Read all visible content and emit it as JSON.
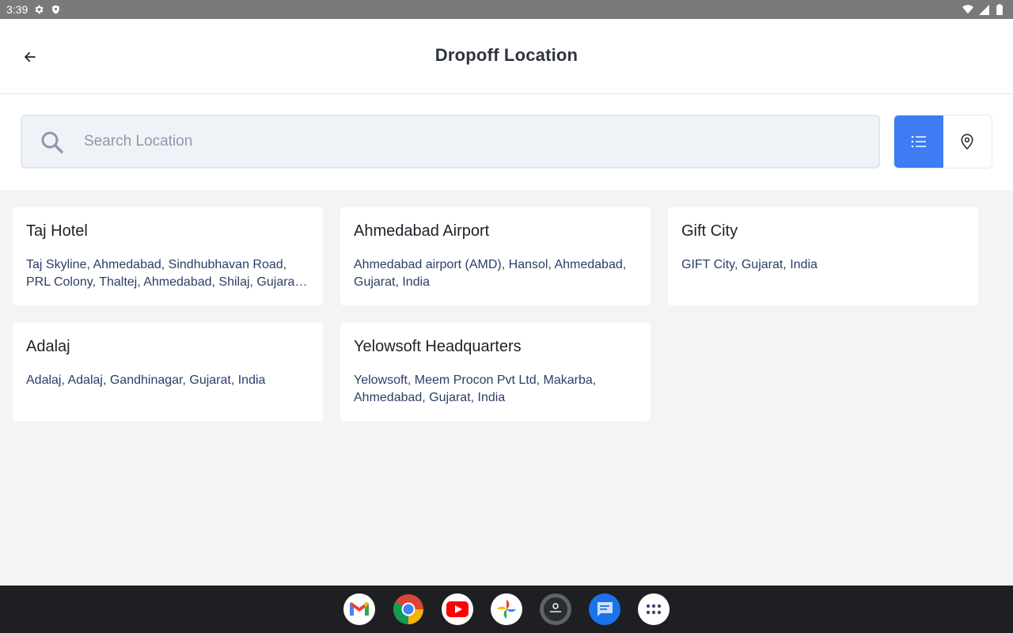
{
  "status_bar": {
    "time": "3:39"
  },
  "header": {
    "title": "Dropoff Location"
  },
  "search": {
    "placeholder": "Search Location",
    "value": ""
  },
  "colors": {
    "accent": "#3d7cf2",
    "background": "#f4f4f5",
    "address_text": "#2c3e66"
  },
  "locations": [
    {
      "name": "Taj Hotel",
      "address": "Taj Skyline, Ahmedabad, Sindhubhavan Road, PRL Colony, Thaltej, Ahmedabad, Shilaj, Gujarat, India"
    },
    {
      "name": "Ahmedabad Airport",
      "address": "Ahmedabad airport (AMD), Hansol, Ahmedabad, Gujarat, India"
    },
    {
      "name": "Gift City",
      "address": "GIFT City, Gujarat, India"
    },
    {
      "name": "Adalaj",
      "address": "Adalaj, Adalaj, Gandhinagar, Gujarat, India"
    },
    {
      "name": "Yelowsoft Headquarters",
      "address": "Yelowsoft, Meem Procon Pvt Ltd, Makarba, Ahmedabad, Gujarat, India"
    }
  ],
  "view_toggle": {
    "active": "list",
    "icons": [
      "list-icon",
      "map-pin-icon"
    ]
  },
  "taskbar": {
    "apps": [
      "gmail-icon",
      "chrome-icon",
      "youtube-icon",
      "photos-icon",
      "app-icon",
      "messages-icon",
      "app-drawer-icon"
    ]
  }
}
